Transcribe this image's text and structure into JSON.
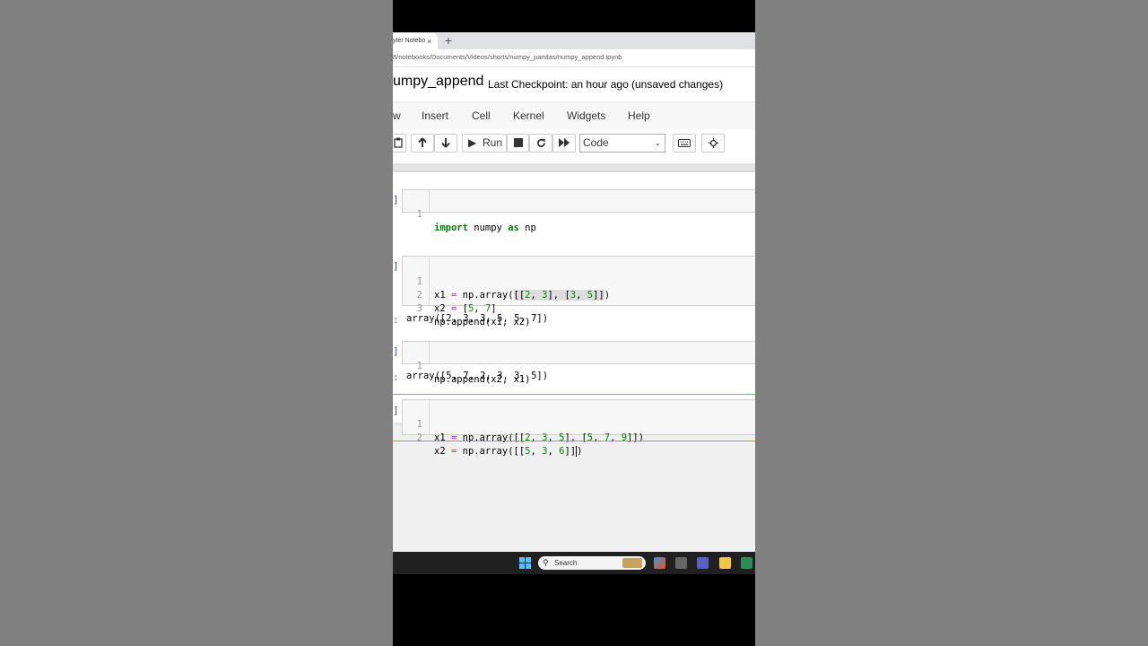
{
  "browser": {
    "tab_title": "yter Notebo",
    "tab_close": "×",
    "new_tab": "+",
    "url": "8/notebooks/Documents/Videos/shorts/numpy_pandas/numpy_append.ipynb"
  },
  "header": {
    "notebook_name": "umpy_append",
    "checkpoint": "Last Checkpoint: an hour ago",
    "unsaved": "(unsaved changes)"
  },
  "menu": {
    "items": [
      "w",
      "Insert",
      "Cell",
      "Kernel",
      "Widgets",
      "Help"
    ]
  },
  "toolbar": {
    "run_label": "Run",
    "cell_type": "Code",
    "icons": [
      "paste-icon",
      "move-up-icon",
      "move-down-icon",
      "run-icon",
      "stop-icon",
      "restart-icon",
      "fast-forward-icon",
      "keyboard-icon",
      "crosshair-icon"
    ]
  },
  "cells": [
    {
      "lines": [
        {
          "n": "1",
          "text": "import numpy as np"
        }
      ]
    },
    {
      "lines": [
        {
          "n": "1",
          "text": "x1 = np.array([[2, 3], [3, 5]])"
        },
        {
          "n": "2",
          "text": "x2 = [5, 7]"
        },
        {
          "n": "3",
          "text": "np.append(x1, x2)"
        }
      ],
      "output": "array([2, 3, 3, 5, 5, 7])"
    },
    {
      "lines": [
        {
          "n": "1",
          "text": "np.append(x2, x1)"
        }
      ],
      "output": "array([5, 7, 2, 3, 3, 5])"
    },
    {
      "lines": [
        {
          "n": "1",
          "text": "x1 = np.array([[2, 3, 5], [5, 7, 9]])"
        },
        {
          "n": "2",
          "text": "x2 = np.array([[5, 3, 6]])"
        }
      ]
    }
  ],
  "prompt_marks": {
    "input": "]",
    "output": ":"
  },
  "taskbar": {
    "search_placeholder": "Search"
  },
  "colors": {
    "keyword": "#008000",
    "number": "#008800",
    "operator": "#aa22ff",
    "active_cell": "#66bb6a",
    "taskbar": "#202020"
  }
}
